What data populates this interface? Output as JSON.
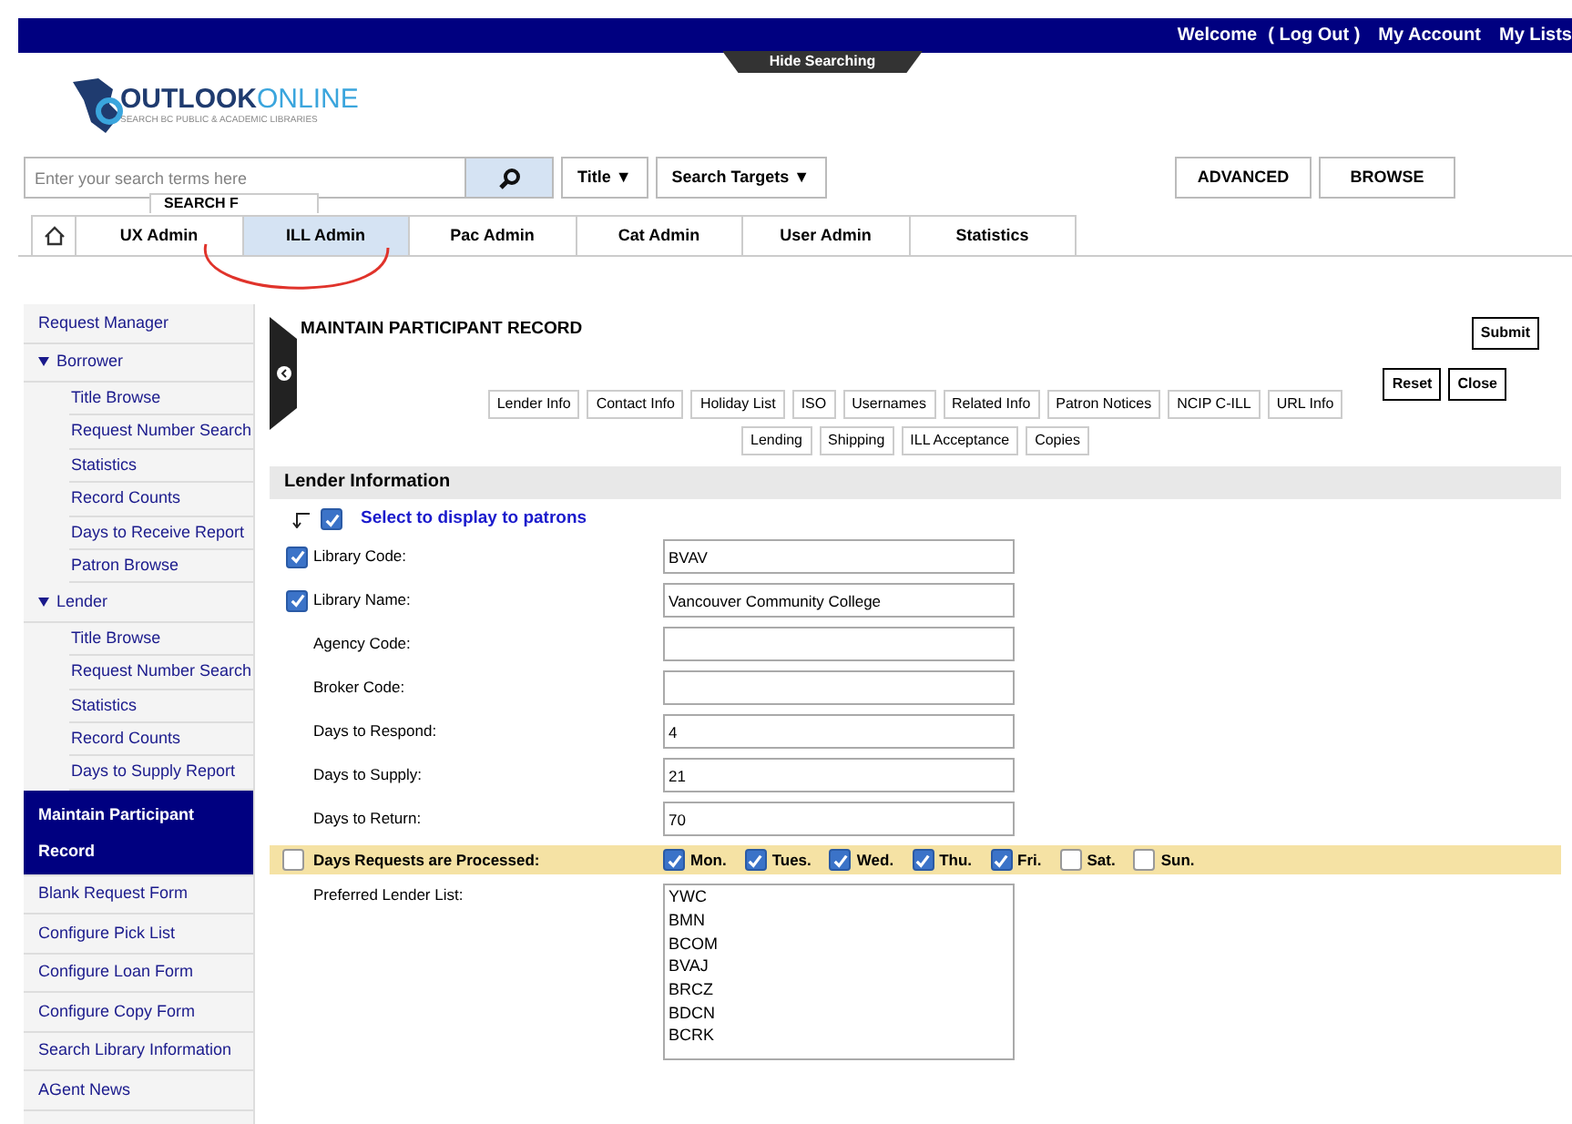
{
  "top_bar": {
    "links": [
      "Welcome",
      "( Log Out )",
      "My Account",
      "My Lists"
    ]
  },
  "hide_searching": "Hide Searching",
  "logo": {
    "word1": "OUTLOOK",
    "word2": "ONLINE",
    "tagline": "SEARCH BC PUBLIC & ACADEMIC LIBRARIES"
  },
  "search": {
    "placeholder": "Enter your search terms here",
    "dropdowns": [
      "Title ▼",
      "Search Targets ▼"
    ],
    "buttons": [
      "ADVANCED",
      "BROWSE"
    ]
  },
  "tabs": [
    {
      "label": "UX Admin",
      "selected": false
    },
    {
      "label": "ILL Admin",
      "selected": true
    },
    {
      "label": "Pac Admin",
      "selected": false
    },
    {
      "label": "Cat Admin",
      "selected": false
    },
    {
      "label": "User Admin",
      "selected": false
    },
    {
      "label": "Statistics",
      "selected": false
    }
  ],
  "search_popup": "SEARCH F",
  "sidebar": {
    "items": [
      {
        "label": "Request Manager",
        "selected": false
      },
      {
        "label": "Borrower",
        "selected": false,
        "expanded": true,
        "children": [
          {
            "label": "Title Browse",
            "selected": false
          },
          {
            "label": "Request Number Search",
            "selected": false
          },
          {
            "label": "Statistics",
            "selected": false
          },
          {
            "label": "Record Counts",
            "selected": false
          },
          {
            "label": "Days to Receive Report",
            "selected": false
          },
          {
            "label": "Patron Browse",
            "selected": false
          }
        ]
      },
      {
        "label": "Lender",
        "selected": false,
        "expanded": true,
        "children": [
          {
            "label": "Title Browse",
            "selected": false
          },
          {
            "label": "Request Number Search",
            "selected": false
          },
          {
            "label": "Statistics",
            "selected": false
          },
          {
            "label": "Record Counts",
            "selected": false
          },
          {
            "label": "Days to Supply Report",
            "selected": false
          }
        ]
      },
      {
        "label": "Maintain Participant Record",
        "selected": true
      },
      {
        "label": "Blank Request Form",
        "selected": false
      },
      {
        "label": "Configure Pick List",
        "selected": false
      },
      {
        "label": "Configure Loan Form",
        "selected": false
      },
      {
        "label": "Configure Copy Form",
        "selected": false
      },
      {
        "label": "Search Library Information",
        "selected": false
      },
      {
        "label": "AGent News",
        "selected": false
      }
    ]
  },
  "page": {
    "title": "MAINTAIN PARTICIPANT RECORD",
    "buttons": [
      "Submit",
      "Reset",
      "Close"
    ],
    "section_tabs": [
      [
        "Lender Info",
        "Contact Info",
        "Holiday List",
        "ISO",
        "Usernames",
        "Related Info",
        "Patron Notices",
        "NCIP C-ILL",
        "URL Info"
      ],
      [
        "Lending",
        "Shipping",
        "ILL Acceptance",
        "Copies"
      ]
    ],
    "section_title": "Lender Information",
    "display_hint": {
      "label": "Select to display to patrons",
      "checked": true
    },
    "fields": [
      {
        "label": "Library Code:",
        "value": "BVAV",
        "checked": true
      },
      {
        "label": "Library Name:",
        "value": "Vancouver Community College",
        "checked": true
      },
      {
        "label": "Agency Code:"
      },
      {
        "label": "Broker Code:"
      },
      {
        "label": "Days to Respond:",
        "value": "4"
      },
      {
        "label": "Days to Supply:",
        "value": "21"
      },
      {
        "label": "Days to Return:",
        "value": "70"
      }
    ],
    "days_row": {
      "label": "Days Requests are Processed:",
      "checked": false,
      "days": [
        {
          "label": "Mon.",
          "checked": true
        },
        {
          "label": "Tues.",
          "checked": true
        },
        {
          "label": "Wed.",
          "checked": true
        },
        {
          "label": "Thu.",
          "checked": true
        },
        {
          "label": "Fri.",
          "checked": true
        },
        {
          "label": "Sat.",
          "checked": false
        },
        {
          "label": "Sun.",
          "checked": false
        }
      ]
    },
    "preferred_lenders": {
      "label": "Preferred Lender List:",
      "items": [
        "YWC",
        "BMN",
        "BCOM",
        "BVAJ",
        "BRCZ",
        "BDCN",
        "BCRK"
      ]
    }
  }
}
